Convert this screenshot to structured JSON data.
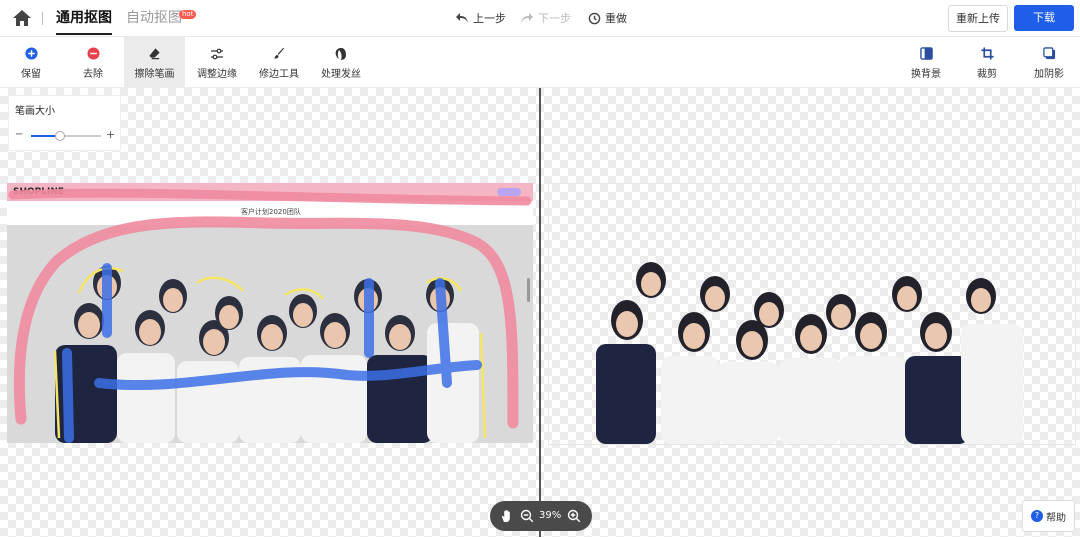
{
  "header": {
    "tab_active": "通用抠图",
    "tab_inactive": "自动抠图",
    "badge": "hot",
    "undo": "上一步",
    "redo": "下一步",
    "reset": "重做",
    "reupload": "重新上传",
    "download": "下载"
  },
  "toolbar": {
    "left_tools": [
      {
        "label": "保留",
        "icon": "plus-circle-icon"
      },
      {
        "label": "去除",
        "icon": "minus-circle-icon"
      },
      {
        "label": "擦除笔画",
        "icon": "eraser-icon"
      },
      {
        "label": "调整边缘",
        "icon": "sliders-icon"
      },
      {
        "label": "修边工具",
        "icon": "brush-icon"
      },
      {
        "label": "处理发丝",
        "icon": "hair-icon"
      }
    ],
    "right_tools": [
      {
        "label": "换背景",
        "icon": "background-icon"
      },
      {
        "label": "裁剪",
        "icon": "crop-icon"
      },
      {
        "label": "加阴影",
        "icon": "shadow-icon"
      }
    ]
  },
  "brush_panel": {
    "title": "笔画大小",
    "minus": "−",
    "plus": "+",
    "level": 0.4
  },
  "source_image": {
    "logo": "SHOPLINE",
    "title": "客户计划2020团队"
  },
  "zoom": {
    "value": "39%"
  },
  "help": {
    "label": "帮助"
  },
  "colors": {
    "accent": "#1e5ee8",
    "keep_stroke": "#f08aa0",
    "remove_stroke": "#3c6fe6",
    "edge": "#f5e663"
  }
}
